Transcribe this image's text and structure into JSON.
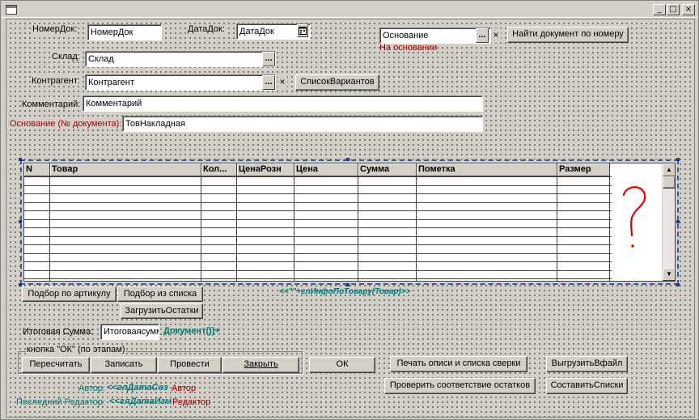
{
  "window": {
    "minimize": "_",
    "maximize": "□",
    "close": "×"
  },
  "header": {
    "nomer_label": "НомерДок:",
    "nomer_value": "НомерДок",
    "data_label": "ДатаДок:",
    "data_value": "ДатаДок",
    "osnovanie_value": "Основание",
    "na_osnovanii": "На основании",
    "find_doc_button": "Найти документ по номеру",
    "sklad_label": "Склад:",
    "sklad_value": "Склад",
    "kontragent_label": "Контрагент:",
    "kontragent_value": "Контрагент",
    "spisok_variantov": "СписокВариантов",
    "comment_label": "Комментарий:",
    "comment_value": "Комментарий",
    "osn_nomer_label": "Основание (№ документа):",
    "osn_nomer_value": "ТовНакладная",
    "select_glyph": "...",
    "clear_glyph": "×"
  },
  "table": {
    "columns": [
      "N",
      "Товар",
      "Кол...",
      "ЦенаРозн",
      "Цена",
      "Сумма",
      "Пометка",
      "Размер"
    ],
    "formula": "<<\"\"+глИнфоПоТовару(Товар)>>",
    "annotation": "?"
  },
  "buttons": {
    "podbor_artikul": "Подбор по артикулу",
    "podbor_spisok": "Подбор из списка",
    "zagruzit_ostatki": "ЗагрузитьОстатки",
    "itogo_label": "Итоговая Сумма:",
    "itogo_value": "Итоговаясумм",
    "itogo_formula": "Документ())+",
    "group_title": "кнопка \"ОК\" (по этапам)",
    "pereschitat": "Пересчитать",
    "zapisat": "Записать",
    "provesti": "Провести",
    "zakryt": "Закрыть",
    "ok": "ОК",
    "pechat": "Печать описи и списка сверки",
    "vygruzit": "ВыгрузитьВфайл",
    "proverit": "Проверить соответствие остатков",
    "sostavit": "СоставитьСписки"
  },
  "footer": {
    "avtor_label": "Автор:",
    "avtor_formula": "<<глДатаСоз",
    "avtor_value": "Автор",
    "redaktor_label": "Последний Редактор:",
    "redaktor_formula": "<<глДатаИзм",
    "redaktor_value": "Редактор"
  }
}
